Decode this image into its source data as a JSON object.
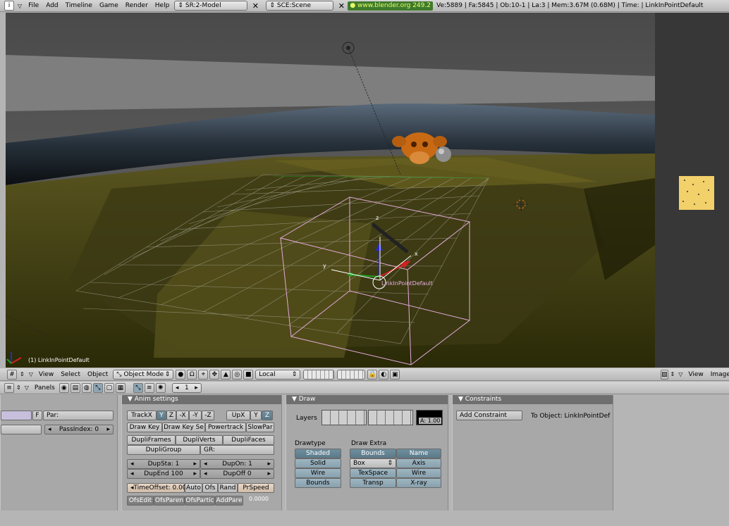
{
  "top_header": {
    "menus": [
      "File",
      "Add",
      "Timeline",
      "Game",
      "Render",
      "Help"
    ],
    "screen": "SR:2-Model",
    "scene": "SCE:Scene",
    "link": "www.blender.org 249.2",
    "stats": "Ve:5889 | Fa:5845 | Ob:10-1 | La:3  | Mem:3.67M (0.68M) | Time: | LinkInPointDefault"
  },
  "viewport": {
    "object_label": "(1) LinkInPointDefault",
    "empty_label": "LinkInPointDefault",
    "axis_x": "x",
    "axis_y": "y",
    "axis_z": "z"
  },
  "view3d_header": {
    "menus": [
      "View",
      "Select",
      "Object"
    ],
    "mode": "Object Mode",
    "orientation": "Local"
  },
  "image_header": {
    "menus": [
      "View",
      "Image"
    ]
  },
  "buttons_header": {
    "panels_label": "Panels",
    "frame": "1"
  },
  "left_panel": {
    "f_label": "F",
    "par_label": "Par:",
    "passindex": "PassIndex: 0"
  },
  "anim_panel": {
    "title": "Anim settings",
    "track": [
      "TrackX",
      "Y",
      "Z",
      "-X",
      "-Y",
      "-Z"
    ],
    "up": [
      "UpX",
      "Y",
      "Z"
    ],
    "row2": [
      "Draw Key",
      "Draw Key Se",
      "Powertrack",
      "SlowPar"
    ],
    "row3": [
      "DupliFrames",
      "DupliVerts",
      "DupliFaces"
    ],
    "dupligroup": "DupliGroup",
    "gr": "GR:",
    "dupsta": "DupSta: 1",
    "dupon": "DupOn: 1",
    "dupend": "DupEnd 100",
    "dupoff": "DupOff 0",
    "timeoffset": "TimeOffset: 0.00",
    "row5": [
      "Auto",
      "Ofs",
      "Rand",
      "PrSpeed"
    ],
    "row6": [
      "OfsEdit",
      "OfsParen",
      "OfsPartic",
      "AddPare"
    ],
    "speed": "0.0000"
  },
  "draw_panel": {
    "title": "Draw",
    "layers": "Layers",
    "alpha": "A: 1.00",
    "drawtype": "Drawtype",
    "drawextra": "Draw Extra",
    "types": [
      "Shaded",
      "Solid",
      "Wire",
      "Bounds"
    ],
    "extra_col1": [
      "Bounds",
      "Box",
      "TexSpace",
      "Transp"
    ],
    "extra_col2": [
      "Name",
      "Axis",
      "Wire",
      "X-ray"
    ]
  },
  "constraints_panel": {
    "title": "Constraints",
    "add": "Add Constraint",
    "to": "To Object: LinkInPointDef"
  }
}
